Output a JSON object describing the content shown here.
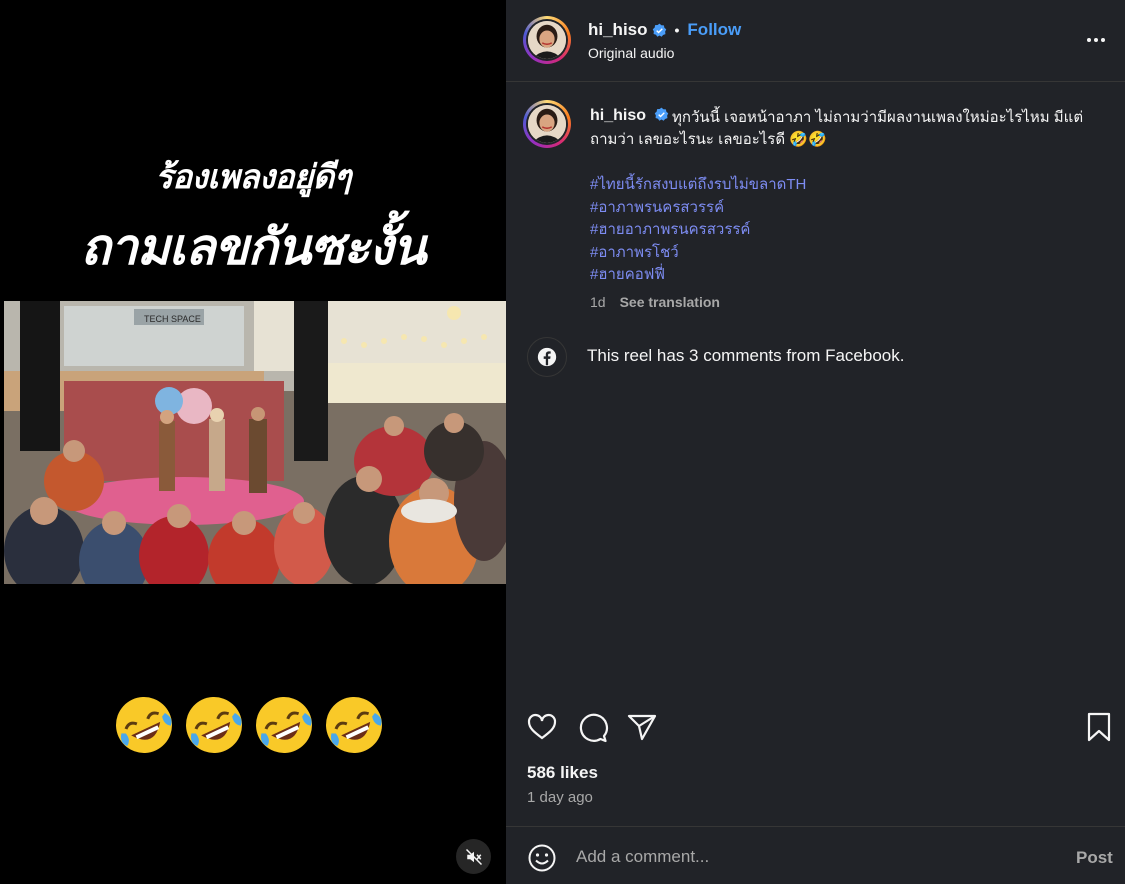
{
  "media": {
    "caption_line1": "ร้องเพลงอยู่ดีๆ",
    "caption_line2": "ถามเลขกันซะงั้น",
    "photo_sign": "TECH SPACE",
    "emoji_count": 4,
    "emoji_name": "rolling-on-the-floor-laughing",
    "mute_icon": "speaker-muted-icon"
  },
  "header": {
    "username": "hi_hiso",
    "separator": "•",
    "follow_label": "Follow",
    "audio_label": "Original audio",
    "more_icon": "more-options-icon"
  },
  "caption": {
    "username": "hi_hiso",
    "text": "ทุกวันนี้ เจอหน้าอาภา ไม่ถามว่ามีผลงานเพลงใหม่อะไรไหม มีแต่ถามว่า เลขอะไรนะ เลขอะไรดี 🤣🤣",
    "hashtags": [
      "#ไทยนี้รักสงบแต่ถึงรบไม่ขลาดTH",
      "#อาภาพรนครสวรรค์",
      "#ฮายอาภาพรนครสวรรค์",
      "#อาภาพรโชว์",
      "#ฮายคอฟฟี่"
    ],
    "age": "1d",
    "translate_label": "See translation"
  },
  "facebook_notice": "This reel has 3 comments from Facebook.",
  "stats": {
    "likes": "586 likes",
    "time_ago": "1 day ago"
  },
  "comment": {
    "placeholder": "Add a comment...",
    "post_label": "Post"
  },
  "colors": {
    "panel_bg": "#212328",
    "link_blue": "#4a9df8",
    "hashtag": "#7d8cf2",
    "muted_text": "#a8a8a8"
  }
}
